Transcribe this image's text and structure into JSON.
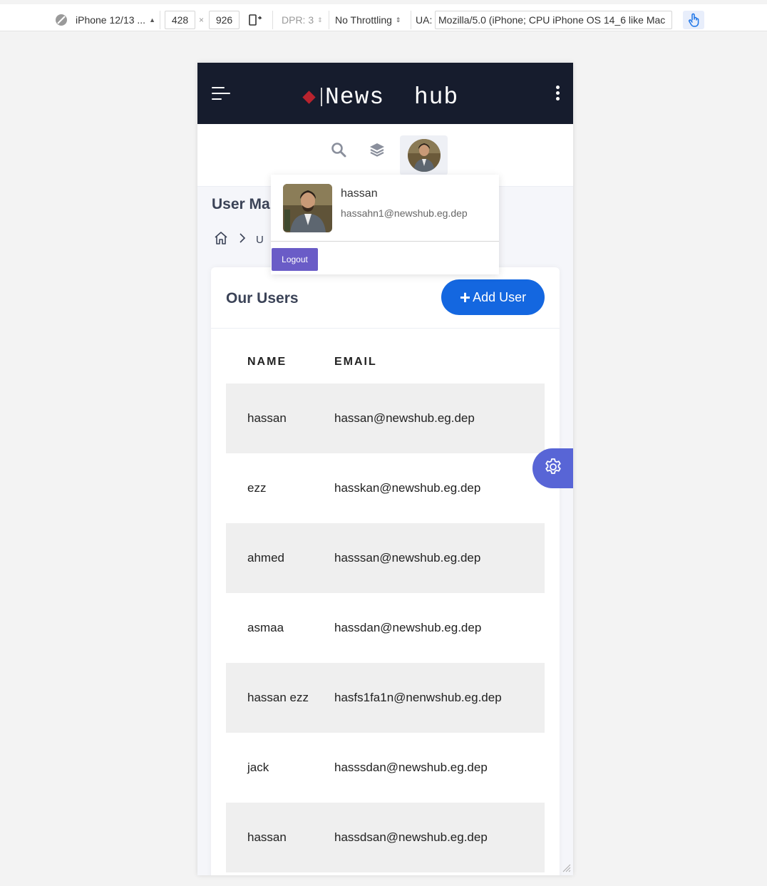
{
  "devtools": {
    "device": "iPhone 12/13 ...",
    "width": "428",
    "times": "×",
    "height": "926",
    "dpr": "DPR: 3",
    "throttling": "No Throttling",
    "ua_label": "UA:",
    "ua_value": "Mozilla/5.0 (iPhone; CPU iPhone OS 14_6 like Mac"
  },
  "navbar": {
    "brand": "News  hub"
  },
  "page": {
    "title": "User Ma",
    "breadcrumb_current": "U"
  },
  "profile_dropdown": {
    "name": "hassan",
    "email": "hassahn1@newshub.eg.dep",
    "logout_label": "Logout"
  },
  "users_card": {
    "title": "Our Users",
    "add_button_label": "Add User",
    "add_button_plus": "+",
    "columns": [
      "NAME",
      "EMAIL"
    ],
    "rows": [
      {
        "name": "hassan",
        "email": "hassan@newshub.eg.dep"
      },
      {
        "name": "ezz",
        "email": "hasskan@newshub.eg.dep"
      },
      {
        "name": "ahmed",
        "email": "hasssan@newshub.eg.dep"
      },
      {
        "name": "asmaa",
        "email": "hassdan@newshub.eg.dep"
      },
      {
        "name": "hassan ezz",
        "email": "hasfs1fa1n@nenwshub.eg.dep"
      },
      {
        "name": "jack",
        "email": "hasssdan@newshub.eg.dep"
      },
      {
        "name": "hassan",
        "email": "hassdsan@newshub.eg.dep"
      }
    ]
  },
  "colors": {
    "navbar": "#161c2d",
    "accent_blue": "#1467e0",
    "logout_purple": "#6a5cc7",
    "settings_fab": "#5865d6",
    "brand_diamond": "#b8232e"
  },
  "icons": {
    "device_toolbar": "no-entry-icon",
    "rotate": "rotate-device-icon",
    "touch": "touch-hand-icon",
    "menu": "hamburger-menu-icon",
    "more": "kebab-menu-icon",
    "search": "search-icon",
    "layers": "layers-icon",
    "home": "home-icon",
    "chevron": "chevron-right-icon",
    "settings": "gear-icon"
  }
}
